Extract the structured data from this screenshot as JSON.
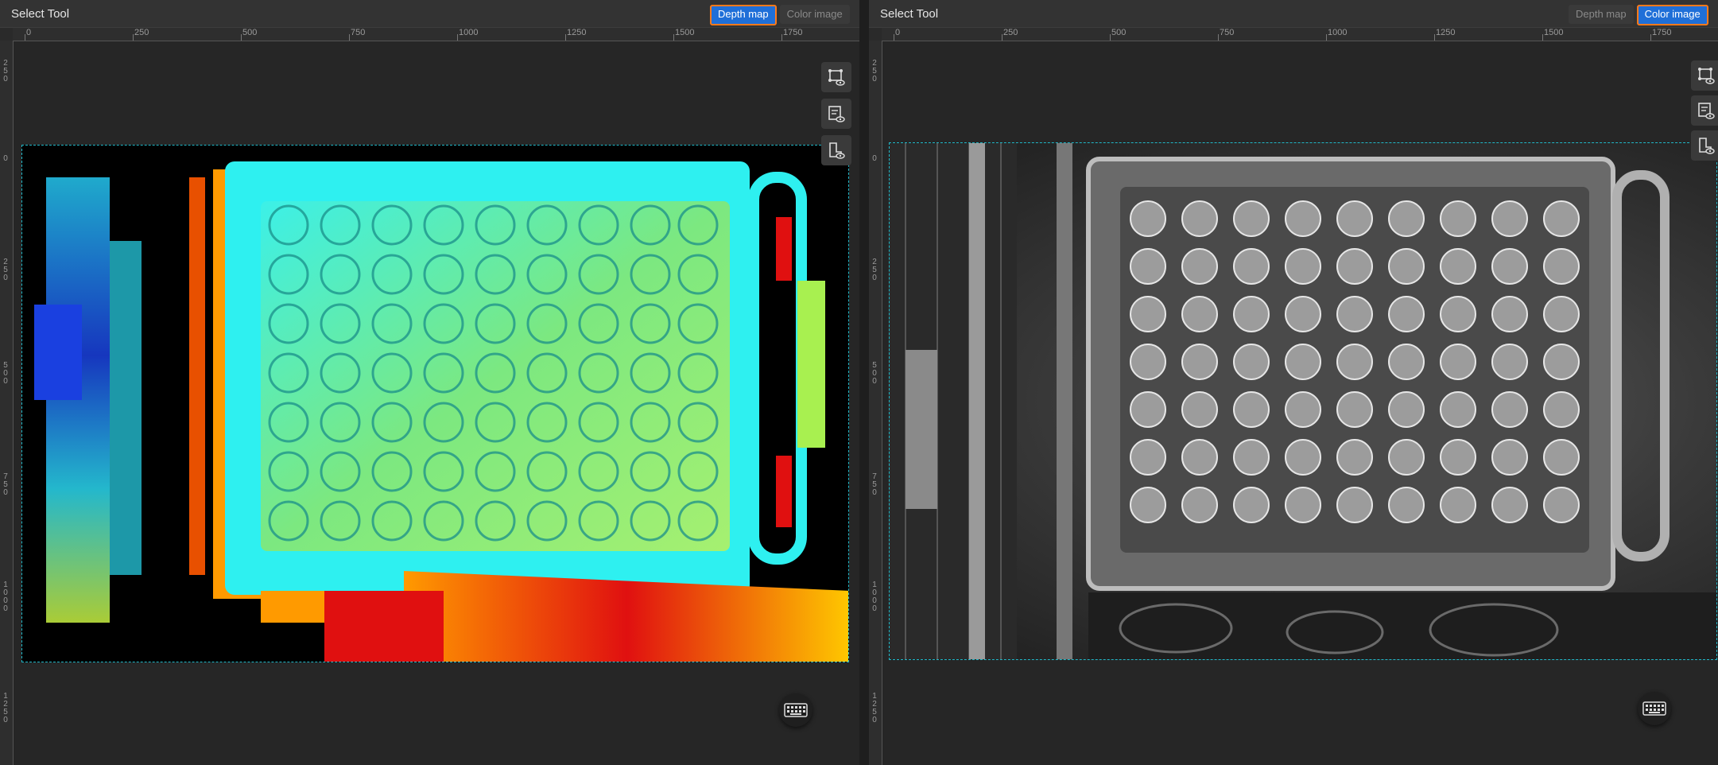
{
  "left_panel": {
    "title": "Select Tool",
    "toggle": {
      "depth_label": "Depth map",
      "color_label": "Color image",
      "active": "depth"
    },
    "ruler_top": [
      "0",
      "250",
      "500",
      "750",
      "1000",
      "1250",
      "1500",
      "1750"
    ],
    "ruler_left": [
      "250",
      "0",
      "250",
      "500",
      "750",
      "1000",
      "1250"
    ],
    "tool_icons": [
      "roi-eye-icon",
      "checklist-eye-icon",
      "mask-eye-icon"
    ],
    "keyboard_icon": "keyboard-icon"
  },
  "right_panel": {
    "title": "Select Tool",
    "toggle": {
      "depth_label": "Depth map",
      "color_label": "Color image",
      "active": "color"
    },
    "ruler_top": [
      "0",
      "250",
      "500",
      "750",
      "1000",
      "1250",
      "1500",
      "1750"
    ],
    "ruler_left": [
      "250",
      "0",
      "250",
      "500",
      "750",
      "1000",
      "1250"
    ],
    "tool_icons": [
      "roi-eye-icon",
      "checklist-eye-icon",
      "mask-eye-icon"
    ],
    "keyboard_icon": "keyboard-icon"
  },
  "colors": {
    "accent_blue": "#1f6fd8",
    "accent_orange": "#ff7a1a",
    "roi_dash": "#20b8c8",
    "depth_cyan": "#2ef0f0",
    "depth_green": "#8fe873",
    "depth_orange": "#ff9a00",
    "depth_red": "#e01010",
    "depth_blue": "#1a40e0"
  }
}
